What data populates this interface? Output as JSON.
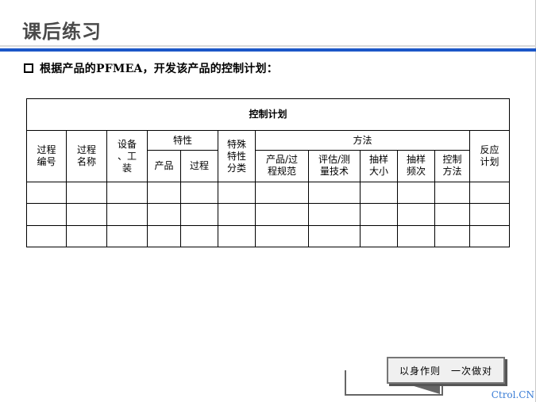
{
  "slide": {
    "title": "课后练习",
    "instruction": "根据产品的PFMEA，开发该产品的控制计划："
  },
  "table": {
    "title": "控制计划",
    "headers": {
      "process_no": "过程\n编号",
      "process_name": "过程\n名称",
      "equipment": "设备\n、工\n装",
      "characteristics": "特性",
      "char_product": "产品",
      "char_process": "过程",
      "special_class": "特殊\n特性\n分类",
      "methods": "方法",
      "spec": "产品/过\n程规范",
      "measurement": "评估/测\n量技术",
      "sample_size": "抽样\n大小",
      "sample_freq": "抽样\n频次",
      "control_method": "控制\n方法",
      "reaction_plan": "反应\n计划"
    },
    "rows": [
      [
        "",
        "",
        "",
        "",
        "",
        "",
        "",
        "",
        "",
        "",
        "",
        ""
      ],
      [
        "",
        "",
        "",
        "",
        "",
        "",
        "",
        "",
        "",
        "",
        "",
        ""
      ],
      [
        "",
        "",
        "",
        "",
        "",
        "",
        "",
        "",
        "",
        "",
        "",
        ""
      ]
    ]
  },
  "footer": {
    "motto": "以身作则　一次做对",
    "watermark": "Ctrol.CN"
  },
  "colors": {
    "accent_blue": "#1c57c8",
    "title_gray": "#4a4a4a",
    "watermark_blue": "#3a7dd6"
  }
}
